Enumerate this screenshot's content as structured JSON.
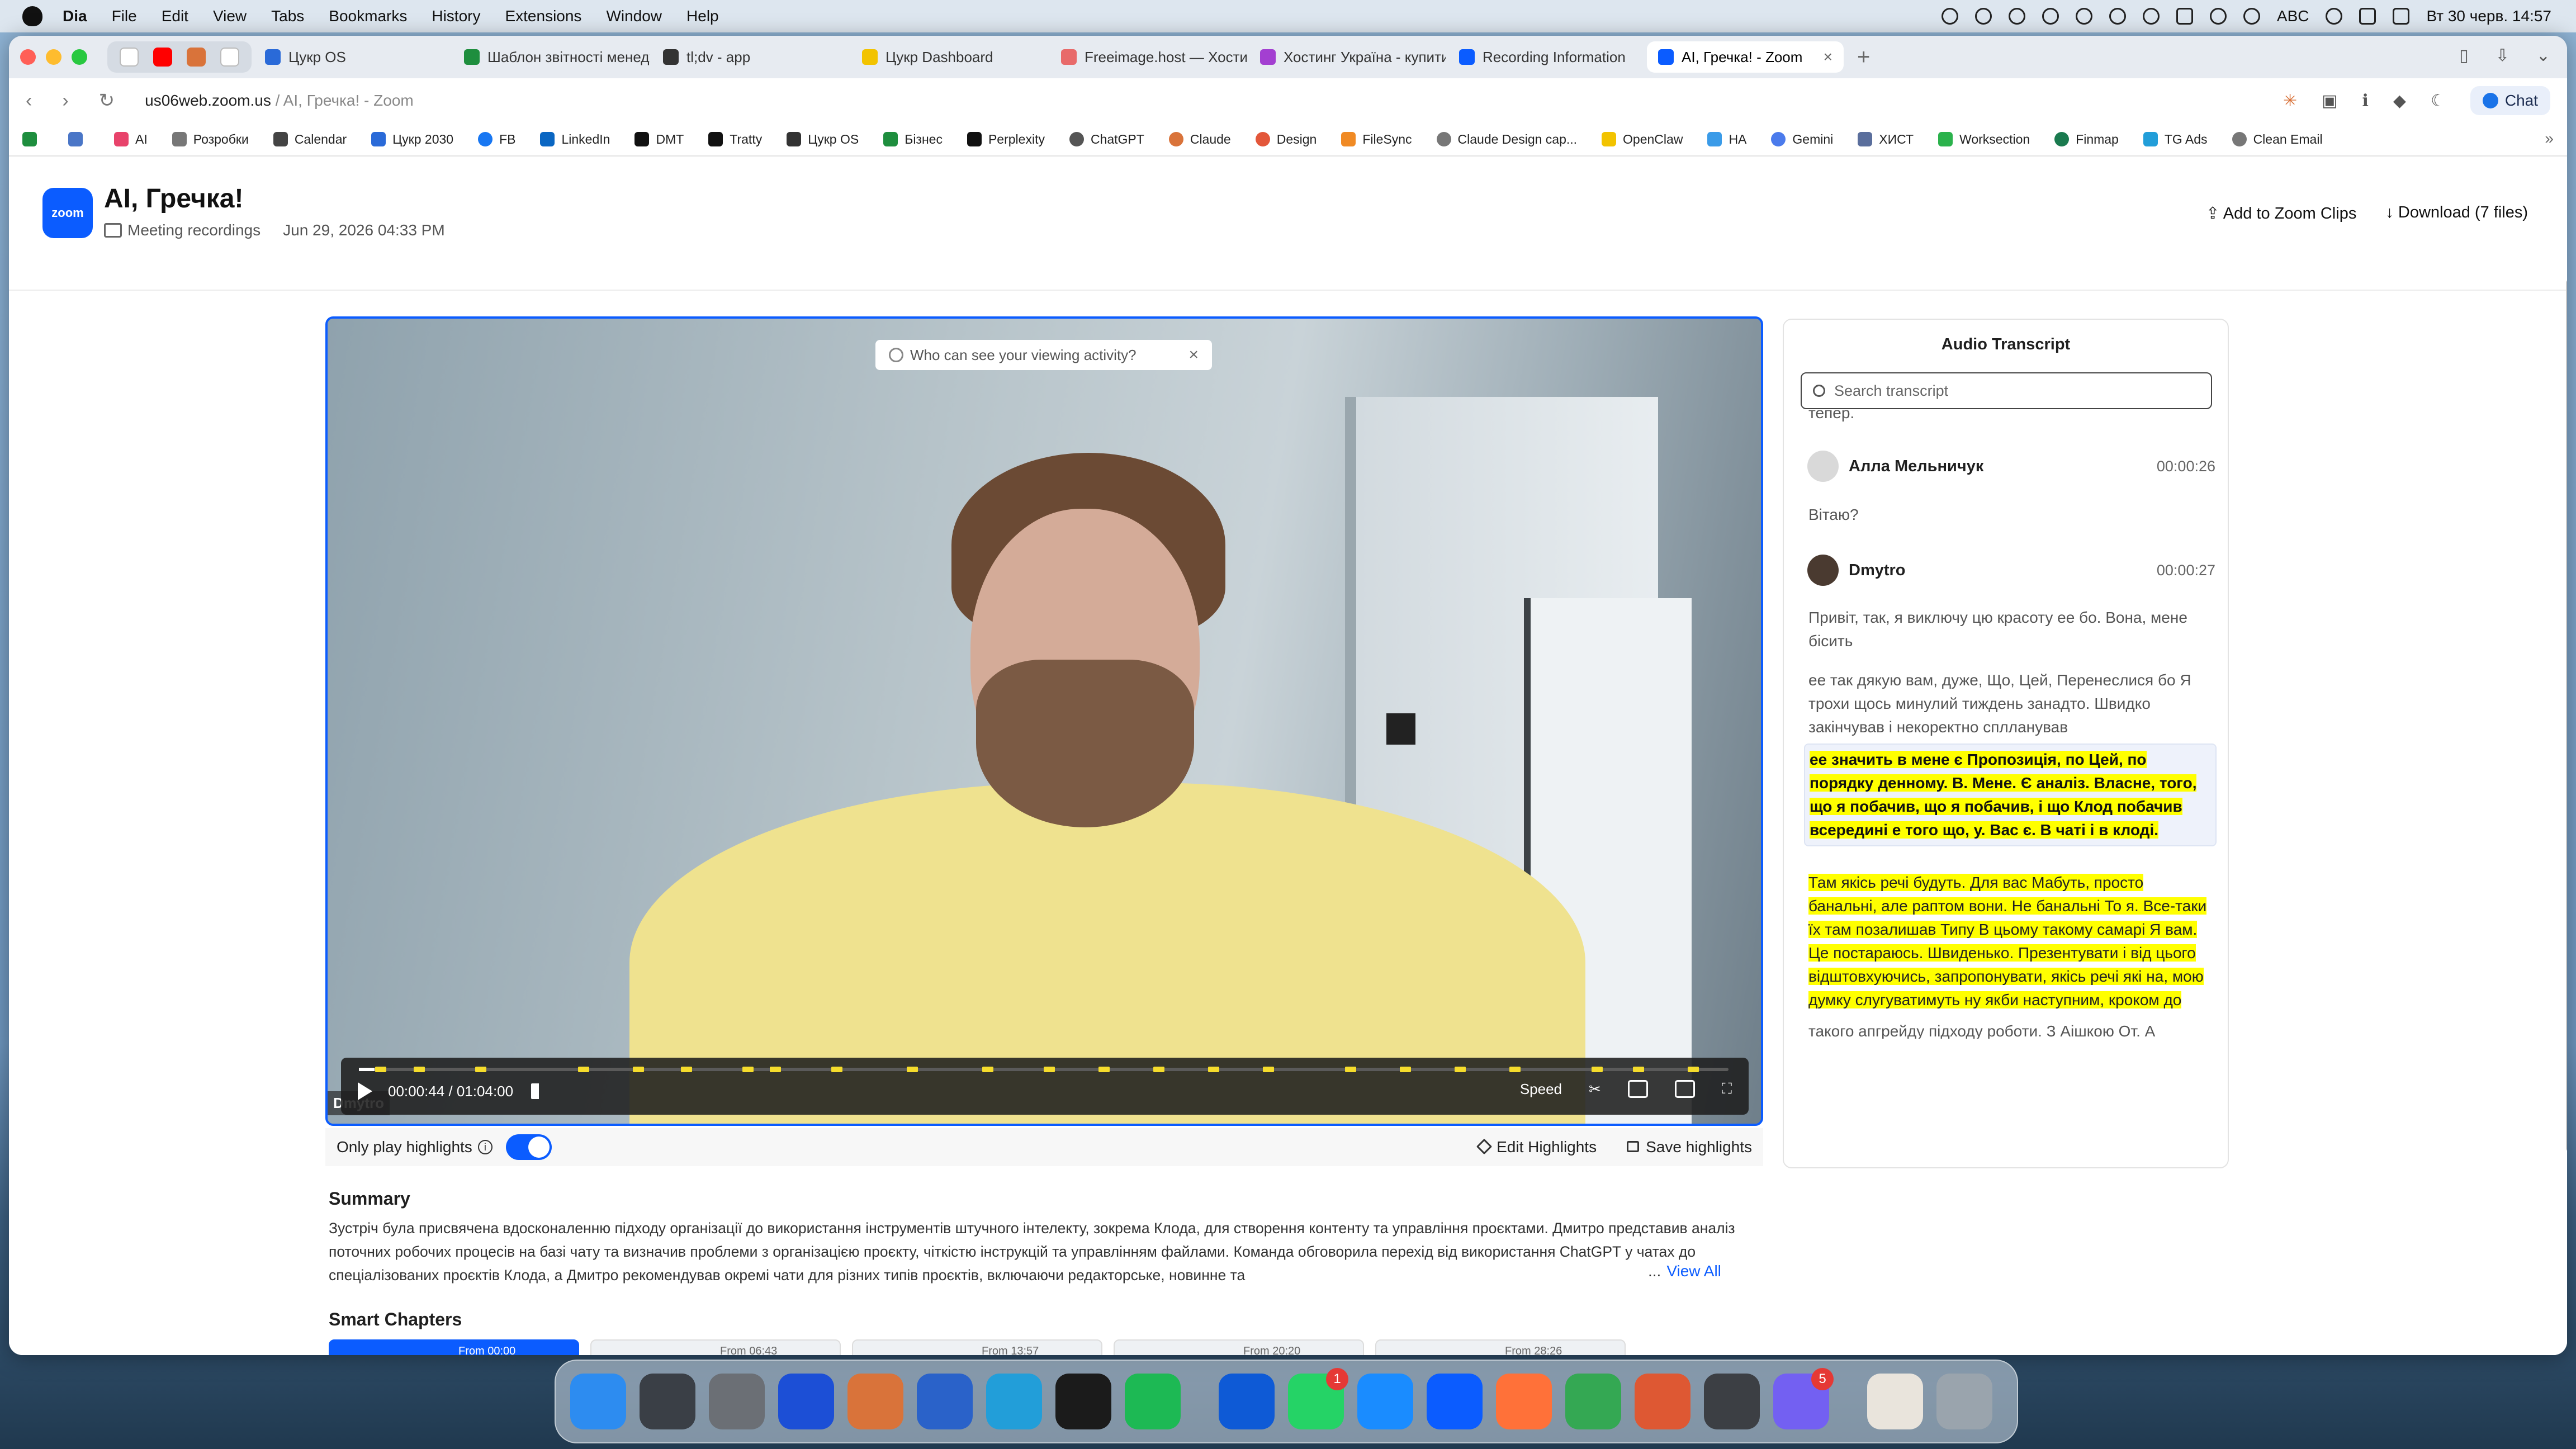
{
  "menubar": {
    "app": "Dia",
    "items": [
      "File",
      "Edit",
      "View",
      "Tabs",
      "Bookmarks",
      "History",
      "Extensions",
      "Window",
      "Help"
    ],
    "input_source": "ABC",
    "clock": "Вт 30 черв.  14:57"
  },
  "tabs": [
    {
      "label": "Цукр OS",
      "color": "#2a6ad8"
    },
    {
      "label": "Шаблон звітності менеджера",
      "color": "#1e8e3e"
    },
    {
      "label": "tl;dv - app",
      "color": "#333333"
    },
    {
      "label": "Цукр Dashboard",
      "color": "#f2c300"
    },
    {
      "label": "Freeimage.host — Хостинг",
      "color": "#e86a6a"
    },
    {
      "label": "Хостинг Україна - купити",
      "color": "#a33fd1"
    },
    {
      "label": "Recording Information",
      "color": "#0b5cff"
    },
    {
      "label": "AI, Гречка! - Zoom",
      "color": "#0b5cff",
      "active": true
    }
  ],
  "address": {
    "domain": "us06web.zoom.us",
    "path": " / AI, Гречка! - Zoom",
    "chat": "Chat"
  },
  "bookmarks": [
    {
      "label": "AI",
      "color": "#e8436b"
    },
    {
      "label": "Розробки",
      "color": "#777777"
    },
    {
      "label": "Calendar",
      "color": "#444444"
    },
    {
      "label": "Цукр 2030",
      "color": "#2a6ad8"
    },
    {
      "label": "FB",
      "color": "#1877f2"
    },
    {
      "label": "LinkedIn",
      "color": "#0a66c2"
    },
    {
      "label": "DMT",
      "color": "#111111"
    },
    {
      "label": "Tratty",
      "color": "#111111"
    },
    {
      "label": "Цукр OS",
      "color": "#333333"
    },
    {
      "label": "Бізнес",
      "color": "#1e8e3e"
    },
    {
      "label": "Perplexity",
      "color": "#111111"
    },
    {
      "label": "ChatGPT",
      "color": "#555555"
    },
    {
      "label": "Claude",
      "color": "#d9733a"
    },
    {
      "label": "Design",
      "color": "#e3573a"
    },
    {
      "label": "FileSync",
      "color": "#f08a24"
    },
    {
      "label": "Claude Design cap...",
      "color": "#777777"
    },
    {
      "label": "OpenClaw",
      "color": "#f2c300"
    },
    {
      "label": "НА",
      "color": "#3a9be8"
    },
    {
      "label": "Gemini",
      "color": "#4b7bec"
    },
    {
      "label": "ХИСТ",
      "color": "#5a6e9c"
    },
    {
      "label": "Worksection",
      "color": "#2bb24c"
    },
    {
      "label": "Finmap",
      "color": "#1a7a4f"
    },
    {
      "label": "TG Ads",
      "color": "#229ed9"
    },
    {
      "label": "Clean Email",
      "color": "#777777"
    }
  ],
  "meeting": {
    "logo": "zoom",
    "title": "AI, Гречка!",
    "folder": "Meeting recordings",
    "date": "Jun 29, 2026 04:33 PM",
    "add_clips": "Add to Zoom Clips",
    "download": "Download (7 files)"
  },
  "player": {
    "privacy_tip": "Who can see your viewing activity?",
    "speaker_label": "Dmytro",
    "current_time": "00:00:44",
    "separator": " / ",
    "duration": "01:04:00",
    "progress": 0.0115,
    "speed": "Speed",
    "only_highlights": "Only play highlights",
    "only_highlights_on": true,
    "edit_highlights": "Edit Highlights",
    "save_highlights": "Save highlights"
  },
  "summary": {
    "heading": "Summary",
    "text": "Зустріч була присвячена вдосконаленню підходу організації до використання інструментів штучного інтелекту, зокрема Клода, для створення контенту та управління проєктами. Дмитро представив аналіз поточних робочих процесів на базі чату та визначив проблеми з організацією проєкту, чіткістю інструкцій та управлінням файлами. Команда обговорила перехід від використання ChatGPT у чатах до спеціалізованих проєктів Клода, а Дмитро рекомендував окремі чати для різних типів проєктів, включаючи редакторське, новинне та",
    "ellipsis": "...",
    "view_all": "View All"
  },
  "chapters": {
    "heading": "Smart Chapters",
    "items": [
      "From 00:00",
      "From 06:43",
      "From 13:57",
      "From 20:20",
      "From 28:26"
    ]
  },
  "transcript": {
    "heading": "Audio Transcript",
    "search_placeholder": "Search transcript",
    "top_fragment": "тепер.",
    "entries": [
      {
        "speaker": "Алла Мельничук",
        "time": "00:00:26",
        "text": "Вітаю?"
      },
      {
        "speaker": "Dmytro",
        "time": "00:00:27",
        "text": "Привіт, так, я виключу цю красоту ее бо. Вона, мене бісить"
      }
    ],
    "seg2": "ее так дякую вам, дуже, Що, Цей, Перенеслися бо Я трохи щось минулий тиждень занадто. Швидко закінчував і некоректно сплланував",
    "current": "ее значить в мене є Пропозиція, по Цей, по порядку денному. В. Мене. Є аналіз. Власне, того, що я побачив, що я побачив, і що Клод побачив всередині е того що, у. Вас є. В чаті і в клоді.",
    "highlighted": "Там якісь речі будуть. Для вас Мабуть, просто банальні, але раптом вони. Не банальні То я. Все-таки їх там позалишав Типу В цьому такому самарі Я вам. Це постараюсь. Швиденько. Презентувати і від цього відштовхуючись, запропонувати, якісь речі які на, мою думку слугуватимуть ну якби наступним, кроком до",
    "tail": "такого апгрейду підходу роботи. З Аішкою От. А"
  },
  "dock": {
    "apps": [
      {
        "name": "finder",
        "color": "#2d8cf0"
      },
      {
        "name": "launchpad",
        "color": "#3a3f46"
      },
      {
        "name": "system-settings",
        "color": "#6b6f75"
      },
      {
        "name": "things",
        "color": "#1c4fd6"
      },
      {
        "name": "claude",
        "color": "#d9733a"
      },
      {
        "name": "weather",
        "color": "#2a62c9"
      },
      {
        "name": "telegram",
        "color": "#229ed9"
      },
      {
        "name": "chatgpt",
        "color": "#1b1b1b"
      },
      {
        "name": "spotify",
        "color": "#1db954"
      },
      {
        "name": "teamviewer",
        "color": "#0e5ad6"
      },
      {
        "name": "whatsapp",
        "color": "#25d366",
        "badge": "1"
      },
      {
        "name": "safari",
        "color": "#1a8cff"
      },
      {
        "name": "zoom",
        "color": "#0b5cff"
      },
      {
        "name": "firefox",
        "color": "#ff7139"
      },
      {
        "name": "chrome",
        "color": "#34a853"
      },
      {
        "name": "duckduckgo",
        "color": "#de5833"
      },
      {
        "name": "server",
        "color": "#3c3f44"
      },
      {
        "name": "viber",
        "color": "#7360f2",
        "badge": "5"
      },
      {
        "name": "documents",
        "color": "#e9e4dc"
      },
      {
        "name": "trash",
        "color": "#9aa4ad"
      }
    ]
  }
}
